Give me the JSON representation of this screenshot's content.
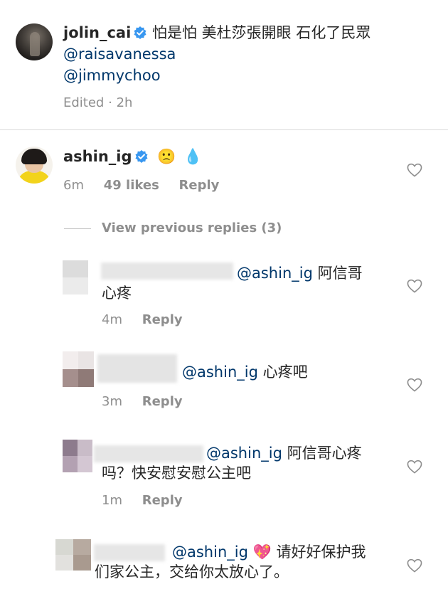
{
  "caption": {
    "username": "jolin_cai",
    "text": "怕是怕 美杜莎張開眼 石化了民眾",
    "mention1": "@raisavanessa",
    "mention2": "@jimmychoo",
    "edited": "Edited",
    "dot": "·",
    "time": "2h"
  },
  "comment": {
    "username": "ashin_ig",
    "emoji1": "🙁",
    "emoji2": "💧",
    "time": "6m",
    "likes": "49 likes",
    "reply": "Reply"
  },
  "view_previous": "View previous replies (3)",
  "replies": [
    {
      "mention": "@ashin_ig",
      "text1": "阿信哥",
      "text2": "心疼",
      "time": "4m",
      "reply": "Reply"
    },
    {
      "mention": "@ashin_ig",
      "text1": "心疼吧",
      "time": "3m",
      "reply": "Reply"
    },
    {
      "mention": "@ashin_ig",
      "text1": "阿信哥心疼",
      "text2": "吗？快安慰安慰公主吧",
      "time": "1m",
      "reply": "Reply"
    },
    {
      "mention": "@ashin_ig",
      "emoji": "💖",
      "text1": "请好好保护我",
      "text2": "们家公主，交给你太放心了。"
    }
  ],
  "colors": {
    "text": "#262626",
    "mention": "#00376b",
    "meta": "#8e8e8e",
    "verified": "#3897f0",
    "divider": "#dbdbdb"
  },
  "icons": {
    "verified": "verified-badge-icon",
    "like": "heart-outline-icon"
  }
}
